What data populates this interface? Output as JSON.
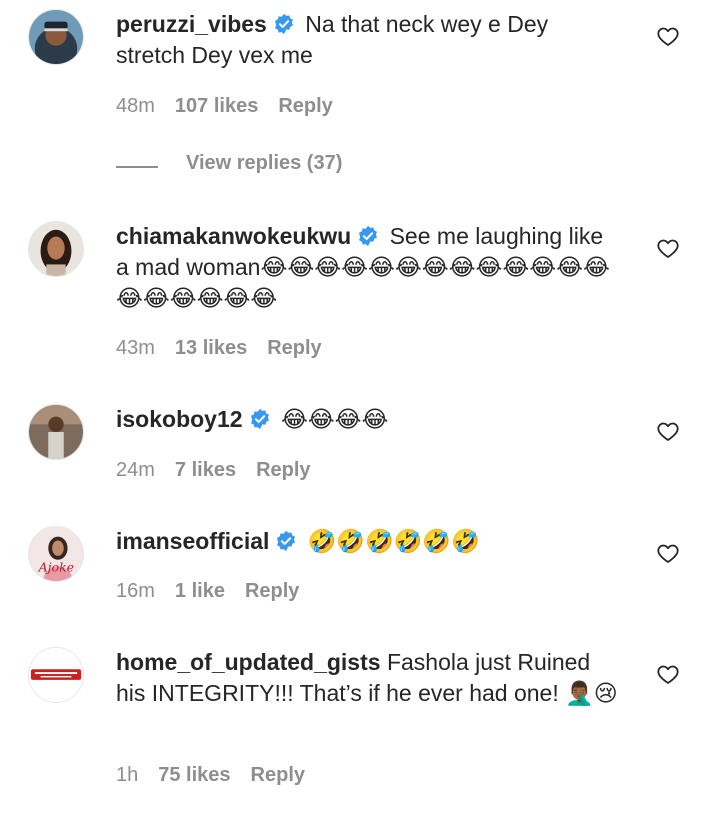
{
  "comments": [
    {
      "username": "peruzzi_vibes",
      "verified": true,
      "text": "Na that neck wey e Dey stretch Dey vex me",
      "time": "48m",
      "likes": "107 likes",
      "reply": "Reply",
      "view_replies": "View replies (37)"
    },
    {
      "username": "chiamakanwokeukwu",
      "verified": true,
      "text": "See me laughing like a mad woman😂😂😂😂😂😂😂😂😂😂😂😂😂😂😂😂😂😂😂",
      "time": "43m",
      "likes": "13 likes",
      "reply": "Reply"
    },
    {
      "username": "isokoboy12",
      "verified": true,
      "text": "😂😂😂😂",
      "time": "24m",
      "likes": "7 likes",
      "reply": "Reply"
    },
    {
      "username": "imanseofficial",
      "verified": true,
      "text": "🤣🤣🤣🤣🤣🤣",
      "time": "16m",
      "likes": "1 like",
      "reply": "Reply",
      "avatar_text": "Ajoke"
    },
    {
      "username": "home_of_updated_gists",
      "verified": false,
      "text": "Fashola just Ruined his INTEGRITY!!! That’s if he ever had one! 🤦🏾‍♂️😢",
      "time": "1h",
      "likes": "75 likes",
      "reply": "Reply"
    }
  ],
  "icons": {
    "verified": "verified-badge-icon",
    "like": "heart-outline-icon"
  },
  "colors": {
    "verified_blue": "#3897f0",
    "muted": "#8e8e8e",
    "text": "#262626"
  }
}
